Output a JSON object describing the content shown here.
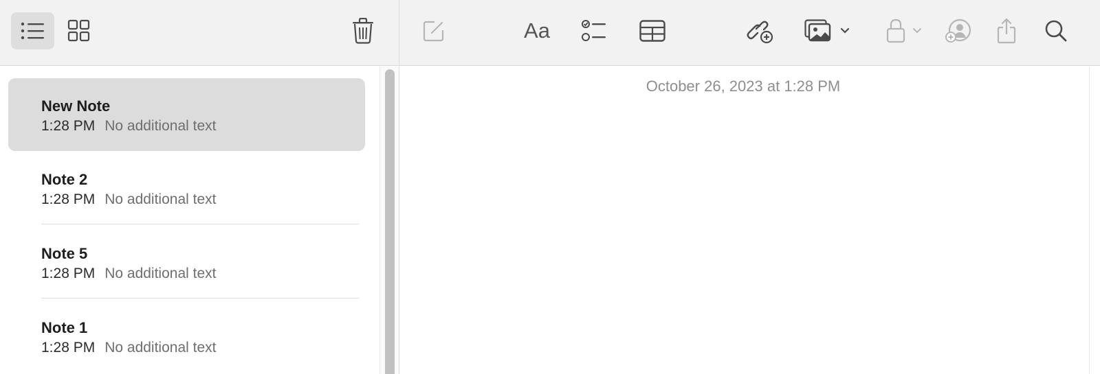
{
  "toolbar": {
    "left": {
      "list_view_icon": "list-icon",
      "gallery_view_icon": "grid-icon",
      "delete_icon": "trash-icon"
    },
    "right": {
      "compose_icon": "compose-icon",
      "format_label": "Aa",
      "checklist_icon": "checklist-icon",
      "table_icon": "table-icon",
      "link_icon": "link-icon",
      "media_icon": "photo-icon",
      "lock_icon": "lock-icon",
      "collaborate_icon": "collaborate-icon",
      "share_icon": "share-icon",
      "search_icon": "search-icon"
    }
  },
  "notes": [
    {
      "title": "New Note",
      "time": "1:28 PM",
      "preview": "No additional text",
      "selected": true
    },
    {
      "title": "Note 2",
      "time": "1:28 PM",
      "preview": "No additional text",
      "selected": false
    },
    {
      "title": "Note 5",
      "time": "1:28 PM",
      "preview": "No additional text",
      "selected": false
    },
    {
      "title": "Note 1",
      "time": "1:28 PM",
      "preview": "No additional text",
      "selected": false
    }
  ],
  "editor": {
    "date": "October 26, 2023 at 1:28 PM"
  },
  "colors": {
    "toolbar_bg": "#f2f2f2",
    "selected_note_bg": "#dcdcdc",
    "icon_color": "#4a4a4a",
    "disabled_icon_color": "#b5b5b5"
  }
}
